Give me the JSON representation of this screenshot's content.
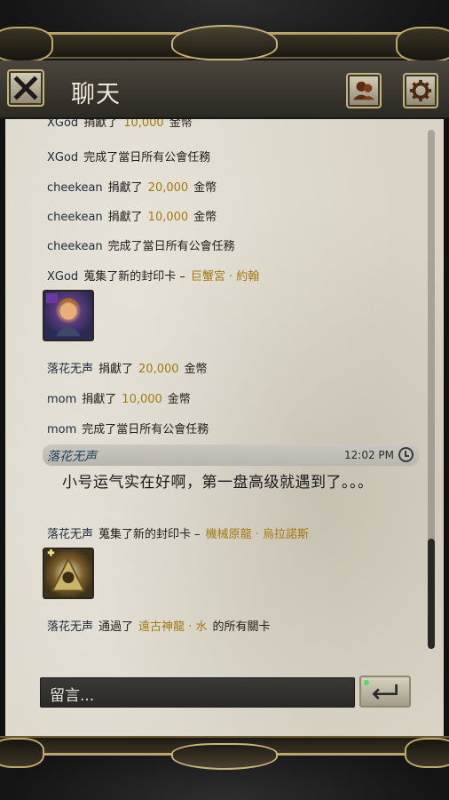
{
  "header": {
    "title": "聊天",
    "close_icon": "close-icon",
    "friends_icon": "friends-icon",
    "settings_icon": "gear-icon"
  },
  "colors": {
    "gold_text": "#a37a10",
    "user_text": "#1d2b39",
    "parchment": "#d9d4c6"
  },
  "messages": [
    {
      "user": "XGod",
      "verb": "捐獻了",
      "amount": "10,000",
      "unit": "金幣"
    },
    {
      "user": "XGod",
      "text": "完成了當日所有公會任務"
    },
    {
      "user": "cheekean",
      "verb": "捐獻了",
      "amount": "20,000",
      "unit": "金幣"
    },
    {
      "user": "cheekean",
      "verb": "捐獻了",
      "amount": "10,000",
      "unit": "金幣"
    },
    {
      "user": "cheekean",
      "text": "完成了當日所有公會任務"
    },
    {
      "user": "XGod",
      "verb": "蒐集了新的封印卡 –",
      "card": "巨蟹宮 · 約翰"
    },
    {
      "user": "落花无声",
      "verb": "捐獻了",
      "amount": "20,000",
      "unit": "金幣"
    },
    {
      "user": "mom",
      "verb": "捐獻了",
      "amount": "10,000",
      "unit": "金幣"
    },
    {
      "user": "mom",
      "text": "完成了當日所有公會任務"
    }
  ],
  "chat_message": {
    "user": "落花无声",
    "time": "12:02 PM",
    "text": "小号运气实在好啊，第一盘高级就遇到了。。。"
  },
  "later_messages": [
    {
      "user": "落花无声",
      "verb": "蒐集了新的封印卡 –",
      "card": "機械原龍 · 烏拉諾斯"
    },
    {
      "user": "落花无声",
      "verb": "通過了",
      "stage": "遠古神龍 · 水",
      "suffix": "的所有關卡"
    }
  ],
  "input": {
    "placeholder": "留言..."
  }
}
